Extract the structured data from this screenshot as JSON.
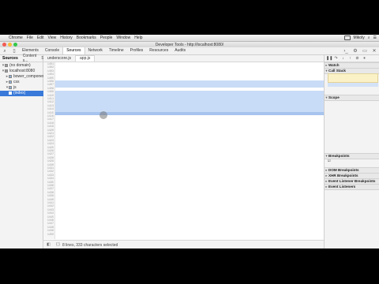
{
  "menubar": {
    "apple_glyph": "",
    "items": [
      {
        "label": "Chrome"
      },
      {
        "label": "File"
      },
      {
        "label": "Edit"
      },
      {
        "label": "View"
      },
      {
        "label": "History"
      },
      {
        "label": "Bookmarks"
      },
      {
        "label": "People"
      },
      {
        "label": "Window"
      },
      {
        "label": "Help"
      }
    ],
    "status": {
      "user": "Mikoly"
    }
  },
  "window": {
    "title": "Developer Tools - http://localhost:8080/",
    "tabs": [
      {
        "label": "Elements",
        "active": false
      },
      {
        "label": "Console",
        "active": false
      },
      {
        "label": "Sources",
        "active": true
      },
      {
        "label": "Network",
        "active": false
      },
      {
        "label": "Timeline",
        "active": false
      },
      {
        "label": "Profiles",
        "active": false
      },
      {
        "label": "Resources",
        "active": false
      },
      {
        "label": "Audits",
        "active": false
      }
    ]
  },
  "navigator": {
    "tabs": [
      {
        "label": "Sources",
        "active": true
      },
      {
        "label": "Content s...",
        "active": false
      },
      {
        "label": "Snippets",
        "active": false
      }
    ],
    "tree": [
      {
        "label": "(no domain)",
        "depth": 0,
        "expanded": true,
        "type": "domain",
        "selected": false
      },
      {
        "label": "localhost:8080",
        "depth": 0,
        "expanded": true,
        "type": "domain",
        "selected": false
      },
      {
        "label": "bower_components",
        "depth": 1,
        "expanded": false,
        "type": "folder",
        "selected": false
      },
      {
        "label": "css",
        "depth": 1,
        "expanded": false,
        "type": "folder",
        "selected": false
      },
      {
        "label": "js",
        "depth": 1,
        "expanded": true,
        "type": "folder",
        "selected": false
      },
      {
        "label": "(index)",
        "depth": 1,
        "expanded": false,
        "type": "file",
        "selected": true
      }
    ]
  },
  "editor": {
    "tabs": [
      {
        "label": "underscore.js",
        "active": false
      },
      {
        "label": "app.js",
        "active": true
      }
    ],
    "line_numbers": [
      "1401",
      "1402",
      "1403",
      "1404",
      "1405",
      "1406",
      "1407",
      "1408",
      "1409",
      "1410",
      "1411",
      "1412",
      "1413",
      "1414",
      "1415",
      "1416",
      "1417",
      "1418",
      "1419",
      "1420",
      "1421",
      "1422",
      "1423",
      "1424",
      "1425",
      "1426",
      "1427",
      "1428",
      "1429",
      "1430",
      "1431",
      "1432",
      "1433",
      "1434",
      "1435",
      "1436",
      "1437",
      "1438",
      "1439",
      "1440",
      "1441",
      "1442",
      "1443",
      "1444",
      "1445",
      "1446",
      "1447",
      "1448",
      "1449",
      "1450"
    ],
    "lines": [
      {
        "text": "",
        "state": "normal"
      },
      {
        "text": "",
        "state": "normal"
      },
      {
        "text": "",
        "state": "normal"
      },
      {
        "text": "",
        "state": "normal"
      },
      {
        "text": "",
        "state": "normal"
      },
      {
        "text": "",
        "state": "hl"
      },
      {
        "text": "",
        "state": "hl"
      },
      {
        "text": "",
        "state": "normal"
      },
      {
        "text": "",
        "state": "hl"
      },
      {
        "text": "",
        "state": "hl"
      },
      {
        "text": "",
        "state": "hl"
      },
      {
        "text": "",
        "state": "hl"
      },
      {
        "text": "",
        "state": "hl"
      },
      {
        "text": "",
        "state": "hl"
      },
      {
        "text": "",
        "state": "exec"
      },
      {
        "text": "",
        "state": "normal"
      },
      {
        "text": "",
        "state": "normal"
      },
      {
        "text": "",
        "state": "normal"
      },
      {
        "text": "",
        "state": "normal"
      },
      {
        "text": "",
        "state": "normal"
      },
      {
        "text": "",
        "state": "normal"
      },
      {
        "text": "",
        "state": "normal"
      },
      {
        "text": "",
        "state": "normal"
      },
      {
        "text": "",
        "state": "normal"
      },
      {
        "text": "",
        "state": "normal"
      },
      {
        "text": "",
        "state": "normal"
      },
      {
        "text": "",
        "state": "normal"
      },
      {
        "text": "",
        "state": "normal"
      },
      {
        "text": "",
        "state": "normal"
      },
      {
        "text": "",
        "state": "normal"
      },
      {
        "text": "",
        "state": "normal"
      },
      {
        "text": "",
        "state": "normal"
      },
      {
        "text": "",
        "state": "normal"
      },
      {
        "text": "",
        "state": "normal"
      },
      {
        "text": "",
        "state": "normal"
      },
      {
        "text": "",
        "state": "normal"
      },
      {
        "text": "",
        "state": "normal"
      },
      {
        "text": "",
        "state": "normal"
      },
      {
        "text": "",
        "state": "normal"
      },
      {
        "text": "",
        "state": "normal"
      },
      {
        "text": "",
        "state": "normal"
      },
      {
        "text": "",
        "state": "normal"
      },
      {
        "text": "",
        "state": "normal"
      },
      {
        "text": "",
        "state": "normal"
      },
      {
        "text": "",
        "state": "normal"
      },
      {
        "text": "",
        "state": "normal"
      },
      {
        "text": "",
        "state": "normal"
      },
      {
        "text": "",
        "state": "normal"
      },
      {
        "text": "",
        "state": "normal"
      },
      {
        "text": "",
        "state": "normal"
      }
    ],
    "status_text": "8 lines, 333 characters selected"
  },
  "debugger": {
    "controls": [
      {
        "name": "pause-resume",
        "glyph": "❚❚"
      },
      {
        "name": "step-over",
        "glyph": "↷"
      },
      {
        "name": "step-into",
        "glyph": "↓"
      },
      {
        "name": "step-out",
        "glyph": "↑"
      },
      {
        "name": "deactivate-breakpoints",
        "glyph": "⊘"
      },
      {
        "name": "pause-on-exceptions",
        "glyph": "⏸"
      }
    ],
    "sections": [
      {
        "label": "Watch",
        "expanded": false
      },
      {
        "label": "Call Stack",
        "expanded": true
      },
      {
        "label": "Scope",
        "expanded": true
      },
      {
        "label": "Breakpoints",
        "expanded": true
      },
      {
        "label": "DOM Breakpoints",
        "expanded": false
      },
      {
        "label": "XHR Breakpoints",
        "expanded": false
      },
      {
        "label": "Event Listener Breakpoints",
        "expanded": false
      },
      {
        "label": "Event Listeners",
        "expanded": false
      }
    ],
    "paused_note": "",
    "call_stack": [
      {
        "fn": "",
        "file": "",
        "selected": true
      },
      {
        "fn": "",
        "file": "",
        "selected": false
      },
      {
        "fn": "",
        "file": "",
        "selected": false
      }
    ],
    "scope": [
      {
        "key": "",
        "value": ""
      },
      {
        "key": "",
        "value": ""
      },
      {
        "key": "",
        "value": ""
      },
      {
        "key": "",
        "value": ""
      },
      {
        "key": "",
        "value": ""
      },
      {
        "key": "",
        "value": ""
      },
      {
        "key": "",
        "value": ""
      },
      {
        "key": "",
        "value": ""
      },
      {
        "key": "",
        "value": ""
      },
      {
        "key": "",
        "value": ""
      },
      {
        "key": "",
        "value": ""
      },
      {
        "key": "",
        "value": ""
      },
      {
        "key": "",
        "value": ""
      }
    ],
    "breakpoints": [
      {
        "file": "",
        "line": ""
      }
    ]
  },
  "colors": {
    "selection": "#3879d9",
    "highlight": "#c9dcf7",
    "exec_line": "#a7c4ee",
    "paused_note_bg": "#fbf1c6"
  },
  "icons": {
    "inspect": "magnifier-icon",
    "device": "phone-icon",
    "settings": "gear-icon",
    "dock": "dock-icon",
    "close": "close-icon"
  }
}
